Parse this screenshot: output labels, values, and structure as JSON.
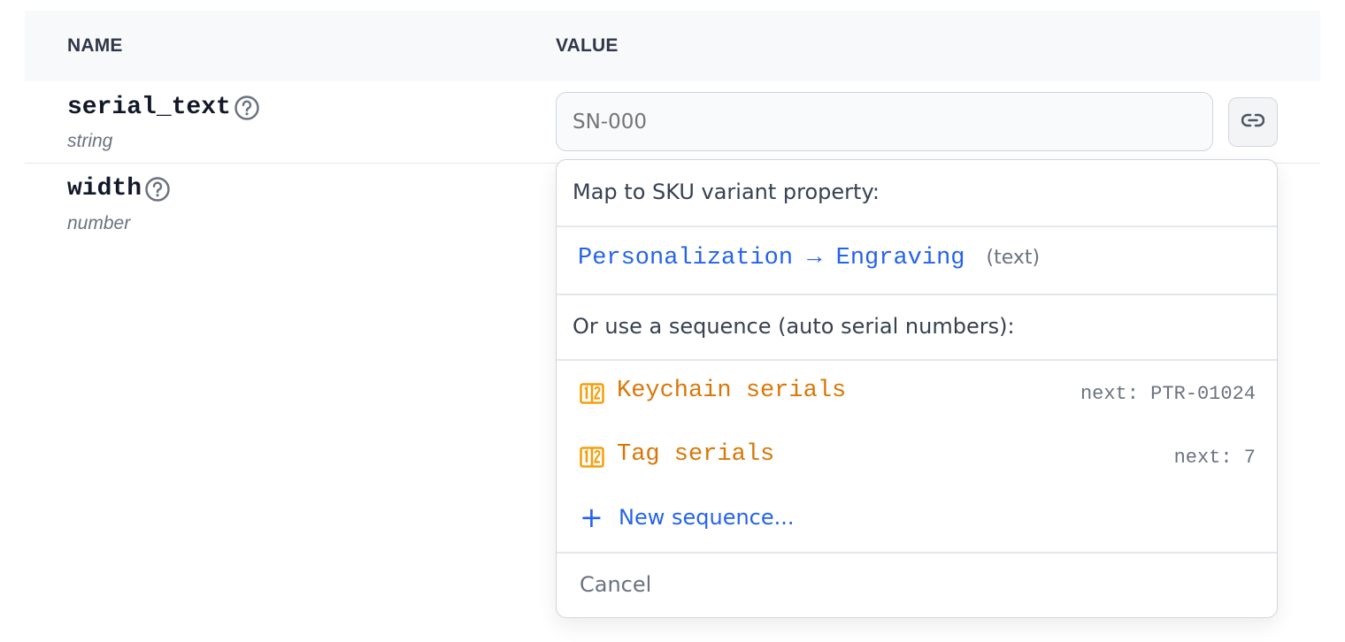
{
  "table": {
    "headers": {
      "name": "NAME",
      "value": "VALUE"
    },
    "rows": [
      {
        "name": "serial_text",
        "type": "string",
        "value_placeholder": "SN-000",
        "help_icon": "question-circle-icon",
        "action_icon": "link-icon"
      },
      {
        "name": "width",
        "type": "number",
        "help_icon": "question-circle-icon"
      }
    ]
  },
  "dropdown": {
    "variant_heading": "Map to SKU variant property:",
    "variant_option": {
      "label": "Personalization → Engraving",
      "type": "(text)"
    },
    "sequence_heading": "Or use a sequence (auto serial numbers):",
    "sequences": [
      {
        "label": "Keychain serials",
        "next": "next: PTR-01024",
        "icon": "sequence-numbers-icon"
      },
      {
        "label": "Tag serials",
        "next": "next: 7",
        "icon": "sequence-numbers-icon"
      }
    ],
    "new_sequence": {
      "icon": "plus-icon",
      "label": "New sequence..."
    },
    "cancel": "Cancel"
  },
  "colors": {
    "accent_blue": "#2563eb",
    "sequence_orange": "#d97706",
    "header_bg": "#f8f9fb",
    "border": "#d1d5db"
  }
}
